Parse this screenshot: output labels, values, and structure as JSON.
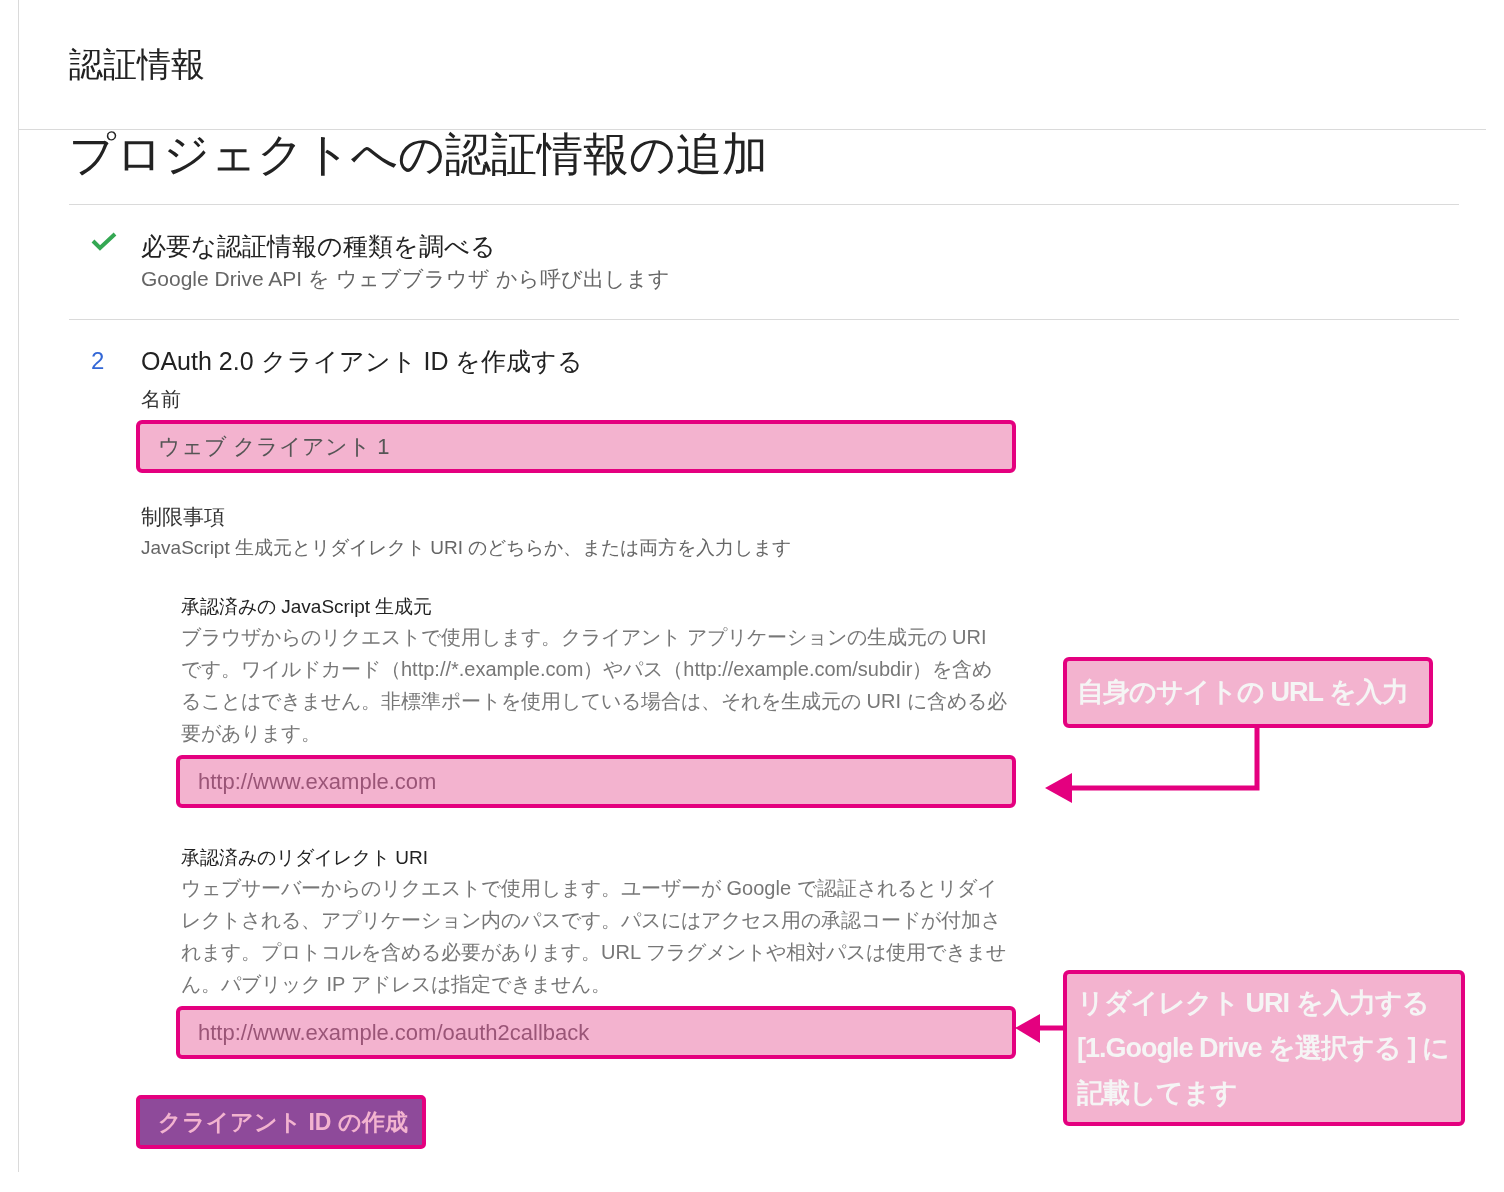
{
  "header": {
    "title": "認証情報"
  },
  "page_title": "プロジェクトへの認証情報の追加",
  "steps": [
    {
      "kind": "done",
      "title": "必要な認証情報の種類を調べる",
      "subtitle": "Google Drive API を ウェブブラウザ から呼び出します"
    },
    {
      "kind": "active",
      "number": "2",
      "title": "OAuth 2.0 クライアント ID を作成する"
    }
  ],
  "form": {
    "name_label": "名前",
    "name_value": "ウェブ クライアント 1",
    "restrictions_label": "制限事項",
    "restrictions_help": "JavaScript 生成元とリダイレクト URI のどちらか、または両方を入力します",
    "origins": {
      "label": "承認済みの JavaScript 生成元",
      "help": "ブラウザからのリクエストで使用します。クライアント アプリケーションの生成元の URI です。ワイルドカード（http://*.example.com）やパス（http://example.com/subdir）を含めることはできません。非標準ポートを使用している場合は、それを生成元の URI に含める必要があります。",
      "placeholder": "http://www.example.com"
    },
    "redirects": {
      "label": "承認済みのリダイレクト URI",
      "help": "ウェブサーバーからのリクエストで使用します。ユーザーが Google で認証されるとリダイレクトされる、アプリケーション内のパスです。パスにはアクセス用の承認コードが付加されます。プロトコルを含める必要があります。URL フラグメントや相対パスは使用できません。パブリック IP アドレスは指定できません。",
      "placeholder": "http://www.example.com/oauth2callback"
    },
    "create_button": "クライアント ID の作成"
  },
  "annotations": [
    {
      "kind": "elbow",
      "lines": [
        "自身のサイトの URL を入力"
      ]
    },
    {
      "kind": "straight",
      "lines": [
        "リダイレクト URI を入力する",
        "[1.Google Drive を選択する ] に",
        "記載してます"
      ]
    }
  ]
}
